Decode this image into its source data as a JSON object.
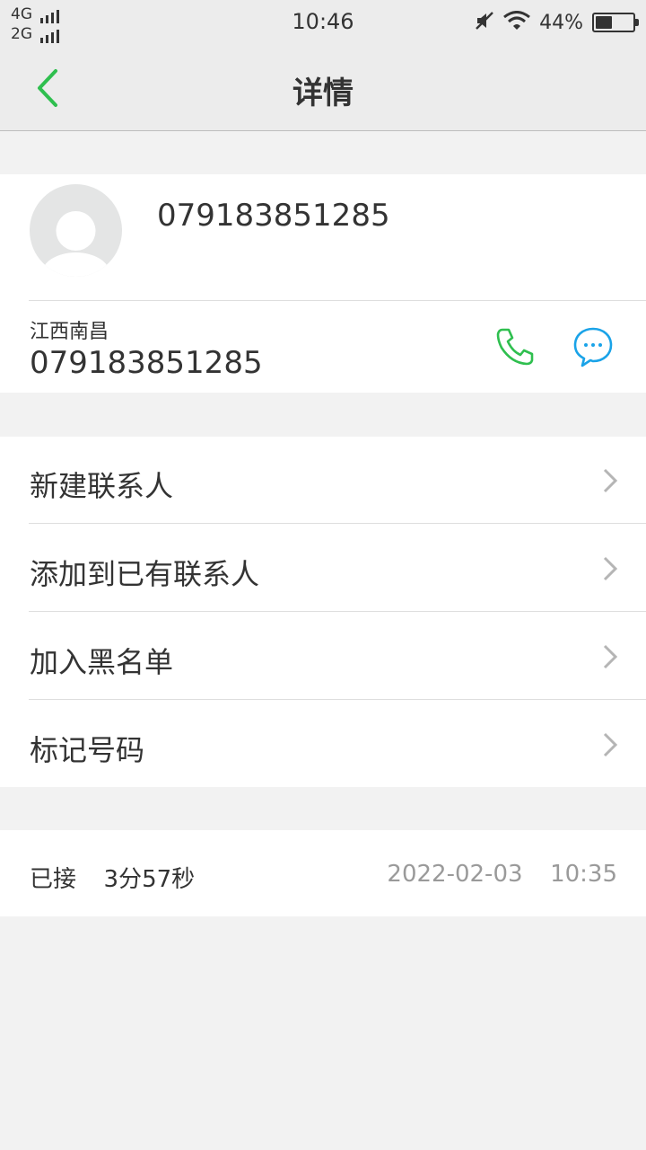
{
  "status_bar": {
    "net1": "4G",
    "net2": "2G",
    "time": "10:46",
    "battery_percent": "44%",
    "battery_level": 0.44
  },
  "nav": {
    "title": "详情"
  },
  "contact": {
    "name": "079183851285",
    "location": "江西南昌",
    "phone": "079183851285"
  },
  "menu": {
    "items": [
      {
        "label": "新建联系人"
      },
      {
        "label": "添加到已有联系人"
      },
      {
        "label": "加入黑名单"
      },
      {
        "label": "标记号码"
      }
    ]
  },
  "record": {
    "status": "已接",
    "duration": "3分57秒",
    "date": "2022-02-03",
    "time": "10:35"
  },
  "colors": {
    "accent_green": "#2fbf4f",
    "accent_blue": "#1aa3e8"
  }
}
